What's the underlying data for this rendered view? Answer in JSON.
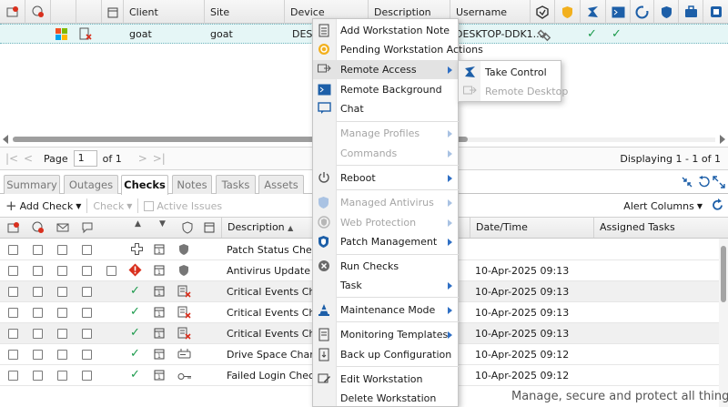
{
  "devices_grid": {
    "columns": [
      "Client",
      "Site",
      "Device",
      "Description",
      "Username"
    ],
    "row": {
      "client": "goat",
      "site": "goat",
      "device": "DESK",
      "username": "DESKTOP-DDK1..."
    }
  },
  "pager": {
    "page_label": "Page",
    "page_value": "1",
    "of_label": "of 1",
    "displaying": "Displaying 1 - 1 of 1"
  },
  "tabs": [
    {
      "label": "Summary"
    },
    {
      "label": "Outages"
    },
    {
      "label": "Checks",
      "active": true
    },
    {
      "label": "Notes"
    },
    {
      "label": "Tasks"
    },
    {
      "label": "Assets"
    }
  ],
  "toolbar": {
    "add_check": "Add Check",
    "check": "Check",
    "active_issues": "Active Issues",
    "alert_columns": "Alert Columns"
  },
  "checks_grid": {
    "columns": {
      "description": "Description",
      "datetime": "Date/Time",
      "assigned": "Assigned Tasks"
    },
    "rows": [
      {
        "description": "Patch Status Check",
        "datetime": ""
      },
      {
        "description": "Antivirus Update Check",
        "datetime": "10-Apr-2025 09:13"
      },
      {
        "description": "Critical Events Check",
        "datetime": "10-Apr-2025 09:13"
      },
      {
        "description": "Critical Events Check",
        "datetime": "10-Apr-2025 09:13"
      },
      {
        "description": "Critical Events Check",
        "datetime": "10-Apr-2025 09:13"
      },
      {
        "description": "Drive Space Change C",
        "datetime": "10-Apr-2025 09:12"
      },
      {
        "description": "Failed Login Check",
        "datetime": "10-Apr-2025 09:12"
      }
    ]
  },
  "context_menu": {
    "items": [
      {
        "label": "Add Workstation Note",
        "icon": "note-icon"
      },
      {
        "label": "Pending Workstation Actions",
        "icon": "pending-icon"
      },
      {
        "label": "Remote Access",
        "icon": "remote-access-icon",
        "submenu": true
      },
      {
        "label": "Remote Background",
        "icon": "terminal-icon"
      },
      {
        "label": "Chat",
        "icon": "chat-icon"
      },
      {
        "label": "Manage Profiles",
        "icon": "",
        "submenu": true,
        "disabled": true
      },
      {
        "label": "Commands",
        "icon": "",
        "submenu": true,
        "disabled": true
      },
      {
        "label": "Reboot",
        "icon": "power-icon",
        "submenu": true
      },
      {
        "label": "Managed Antivirus",
        "icon": "shield-icon",
        "submenu": true,
        "disabled": true
      },
      {
        "label": "Web Protection",
        "icon": "web-shield-icon",
        "submenu": true,
        "disabled": true
      },
      {
        "label": "Patch Management",
        "icon": "patch-shield-icon",
        "submenu": true
      },
      {
        "label": "Run Checks",
        "icon": "run-checks-icon"
      },
      {
        "label": "Task",
        "icon": "",
        "submenu": true
      },
      {
        "label": "Maintenance Mode",
        "icon": "maintenance-icon",
        "submenu": true
      },
      {
        "label": "Monitoring Templates",
        "icon": "template-icon",
        "submenu": true
      },
      {
        "label": "Back up Configuration",
        "icon": "backup-icon"
      },
      {
        "label": "Edit Workstation",
        "icon": "edit-icon"
      },
      {
        "label": "Delete Workstation",
        "icon": ""
      }
    ]
  },
  "remote_submenu": {
    "items": [
      {
        "label": "Take Control",
        "icon": "take-control-icon"
      },
      {
        "label": "Remote Desktop",
        "icon": "remote-desktop-icon",
        "disabled": true
      }
    ]
  },
  "footer_tagline": "Manage, secure and protect all things IT",
  "colors": {
    "accent_blue": "#2f6fc4",
    "ok_green": "#1b9a4b",
    "alert_red": "#d9301e",
    "row_highlight": "#e5f6f6"
  }
}
